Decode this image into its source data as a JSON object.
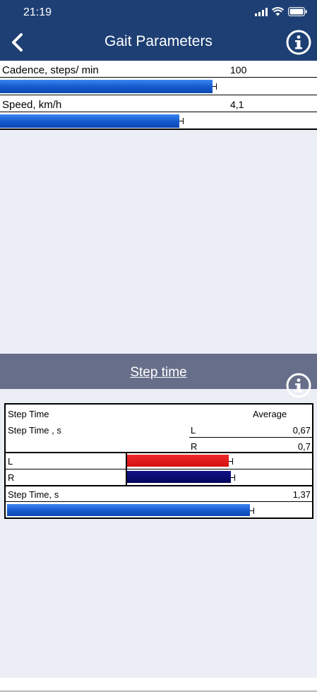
{
  "status_bar": {
    "time": "21:19"
  },
  "header": {
    "title": "Gait Parameters"
  },
  "metrics": [
    {
      "label": "Cadence, steps/ min",
      "value": "100",
      "bar_fraction": 0.67
    },
    {
      "label": "Speed, km/h",
      "value": "4,1",
      "bar_fraction": 0.565
    }
  ],
  "step_section": {
    "title": "Step time",
    "panel": {
      "heading": "Step Time",
      "average_label": "Average",
      "subheading": "Step Time , s",
      "left_label": "L",
      "left_value": "0,67",
      "right_label": "R",
      "right_value": "0,7",
      "bar_left_label": "L",
      "bar_right_label": "R",
      "total_label": "Step Time, s",
      "total_value": "1,37",
      "left_fraction": 0.55,
      "right_fraction": 0.56,
      "total_fraction": 0.8
    }
  },
  "colors": {
    "header": "#1e3f73",
    "section": "#676e8a",
    "bar_blue": "#1458cc",
    "bar_red": "#dd1111",
    "bar_navy": "#0a0a6e"
  }
}
